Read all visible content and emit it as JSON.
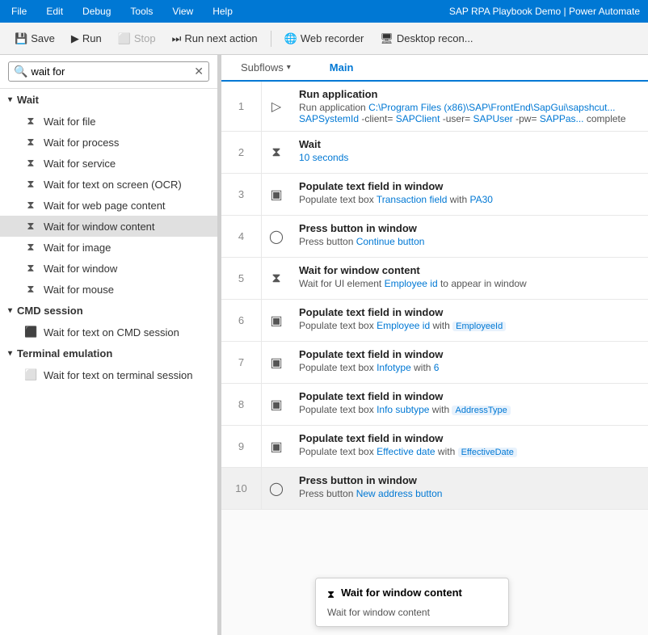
{
  "titleBar": {
    "menuItems": [
      "File",
      "Edit",
      "Debug",
      "Tools",
      "View",
      "Help"
    ],
    "title": "SAP RPA Playbook Demo | Power Automate"
  },
  "toolbar": {
    "saveLabel": "Save",
    "runLabel": "Run",
    "stopLabel": "Stop",
    "runNextLabel": "Run next action",
    "webRecorderLabel": "Web recorder",
    "desktopReconLabel": "Desktop recon..."
  },
  "sidebar": {
    "searchPlaceholder": "wait for",
    "searchValue": "wait for",
    "groups": [
      {
        "id": "wait",
        "label": "Wait",
        "expanded": true,
        "items": [
          {
            "id": "wait-for-file",
            "label": "Wait for file"
          },
          {
            "id": "wait-for-process",
            "label": "Wait for process"
          },
          {
            "id": "wait-for-service",
            "label": "Wait for service"
          },
          {
            "id": "wait-for-text-ocr",
            "label": "Wait for text on screen (OCR)"
          },
          {
            "id": "wait-for-web-page",
            "label": "Wait for web page content"
          },
          {
            "id": "wait-for-window-content",
            "label": "Wait for window content",
            "selected": true
          },
          {
            "id": "wait-for-image",
            "label": "Wait for image"
          },
          {
            "id": "wait-for-window",
            "label": "Wait for window"
          },
          {
            "id": "wait-for-mouse",
            "label": "Wait for mouse"
          }
        ]
      },
      {
        "id": "cmd-session",
        "label": "CMD session",
        "expanded": true,
        "items": [
          {
            "id": "wait-for-text-cmd",
            "label": "Wait for text on CMD session"
          }
        ]
      },
      {
        "id": "terminal-emulation",
        "label": "Terminal emulation",
        "expanded": true,
        "items": [
          {
            "id": "wait-for-text-terminal",
            "label": "Wait for text on terminal session"
          }
        ]
      }
    ]
  },
  "tabs": {
    "subflowsLabel": "Subflows",
    "mainLabel": "Main",
    "activeTab": "Main"
  },
  "flowRows": [
    {
      "num": 1,
      "iconType": "app",
      "title": "Run application",
      "desc": "Run application C:\\Program Files (x86)\\SAP\\FrontEnd\\SapGui\\sapshcut... SAPSystemId -client= SAPClient -user= SAPUser -pw= SAPPas... complete",
      "linkParts": [],
      "highlighted": false
    },
    {
      "num": 2,
      "iconType": "hourglass",
      "title": "Wait",
      "desc": "10 seconds",
      "linkParts": [
        {
          "text": "10 seconds",
          "isLink": true
        }
      ],
      "highlighted": false
    },
    {
      "num": 3,
      "iconType": "window",
      "title": "Populate text field in window",
      "desc": "Populate text box Transaction field with PA30",
      "linkParts": [
        {
          "text": "Populate text box ",
          "isLink": false
        },
        {
          "text": "Transaction field",
          "isLink": true
        },
        {
          "text": " with ",
          "isLink": false
        },
        {
          "text": "PA30",
          "isLink": true
        }
      ],
      "highlighted": false
    },
    {
      "num": 4,
      "iconType": "window-btn",
      "title": "Press button in window",
      "desc": "Press button Continue button",
      "linkParts": [
        {
          "text": "Press button ",
          "isLink": false
        },
        {
          "text": "Continue button",
          "isLink": true
        }
      ],
      "highlighted": false
    },
    {
      "num": 5,
      "iconType": "hourglass",
      "title": "Wait for window content",
      "desc": "Wait for UI element Employee id to appear in window",
      "linkParts": [
        {
          "text": "Wait for UI element ",
          "isLink": false
        },
        {
          "text": "Employee id",
          "isLink": true
        },
        {
          "text": " to appear in window",
          "isLink": false
        }
      ],
      "highlighted": false
    },
    {
      "num": 6,
      "iconType": "window",
      "title": "Populate text field in window",
      "desc": "Populate text box Employee id with EmployeeId",
      "linkParts": [
        {
          "text": "Populate text box ",
          "isLink": false
        },
        {
          "text": "Employee id",
          "isLink": true
        },
        {
          "text": " with ",
          "isLink": false
        },
        {
          "text": "EmployeeId",
          "isLink": true,
          "badge": true
        }
      ],
      "highlighted": false
    },
    {
      "num": 7,
      "iconType": "window",
      "title": "Populate text field in window",
      "desc": "Populate text box Infotype with 6",
      "linkParts": [
        {
          "text": "Populate text box ",
          "isLink": false
        },
        {
          "text": "Infotype",
          "isLink": true
        },
        {
          "text": " with ",
          "isLink": false
        },
        {
          "text": "6",
          "isLink": true
        }
      ],
      "highlighted": false
    },
    {
      "num": 8,
      "iconType": "window",
      "title": "Populate text field in window",
      "desc": "Populate text box Info subtype with AddressType",
      "linkParts": [
        {
          "text": "Populate text box ",
          "isLink": false
        },
        {
          "text": "Info subtype",
          "isLink": true
        },
        {
          "text": " with ",
          "isLink": false
        },
        {
          "text": "AddressType",
          "isLink": true,
          "badge": true
        }
      ],
      "highlighted": false
    },
    {
      "num": 9,
      "iconType": "window",
      "title": "Populate text field in window",
      "desc": "Populate text box Effective date with EffectiveDate",
      "linkParts": [
        {
          "text": "Populate text box ",
          "isLink": false
        },
        {
          "text": "Effective date",
          "isLink": true
        },
        {
          "text": " with ",
          "isLink": false
        },
        {
          "text": "EffectiveDate",
          "isLink": true,
          "badge": true
        }
      ],
      "highlighted": false
    },
    {
      "num": 10,
      "iconType": "window-btn",
      "title": "Press button in window",
      "desc": "Press button New address button",
      "linkParts": [
        {
          "text": "Press button ",
          "isLink": false
        },
        {
          "text": "New address button",
          "isLink": true
        }
      ],
      "highlighted": true
    }
  ],
  "popup": {
    "title": "Wait for window content",
    "desc": "Wait for window content"
  }
}
